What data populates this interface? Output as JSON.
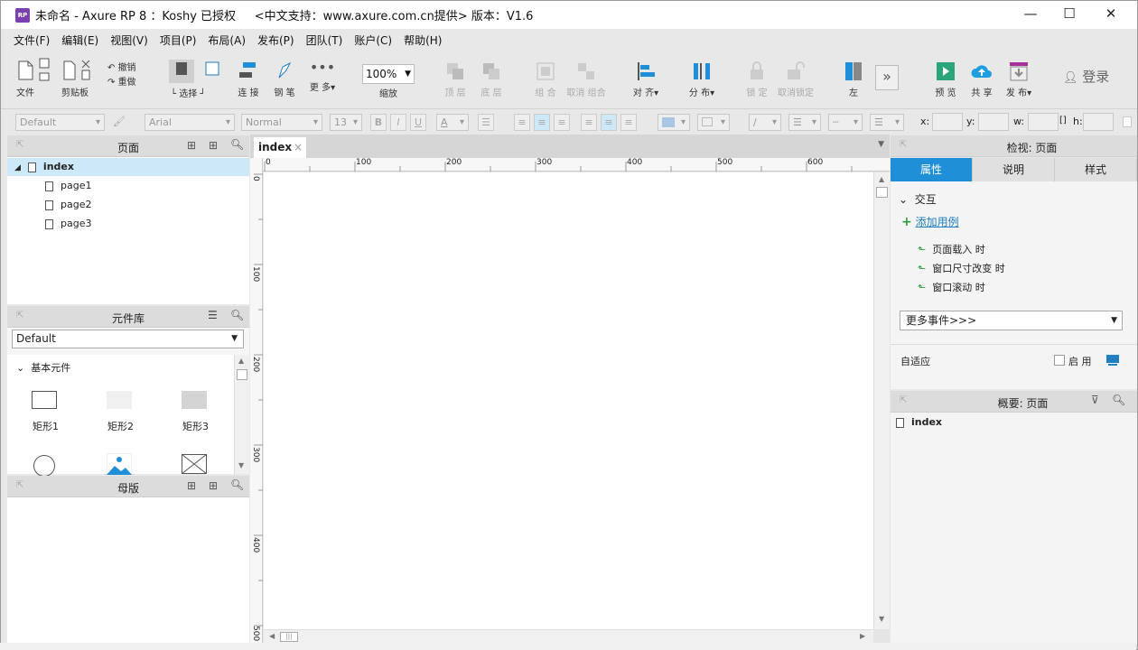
{
  "window": {
    "title": "未命名 - Axure RP 8 ：Koshy 已授权     <中文支持：www.axure.com.cn提供> 版本：V1.6",
    "app_icon_text": "RP",
    "minimize": "—",
    "maximize": "☐",
    "close": "✕"
  },
  "menu": [
    "文件(F)",
    "编辑(E)",
    "视图(V)",
    "项目(P)",
    "布局(A)",
    "发布(P)",
    "团队(T)",
    "账户(C)",
    "帮助(H)"
  ],
  "toolbar": {
    "file": "文件",
    "clipboard": "剪贴板",
    "undo": "撤销",
    "redo": "重做",
    "select": "选择",
    "connect": "连 接",
    "pen": "钢 笔",
    "more": "更 多▾",
    "zoom_value": "100%",
    "zoom": "缩放",
    "top": "顶 层",
    "bottom": "底 层",
    "group": "组 合",
    "ungroup": "取消 组合",
    "align": "对 齐▾",
    "distribute": "分 布▾",
    "lock": "锁 定",
    "unlock": "取消锁定",
    "left": "左",
    "preview": "预 览",
    "share": "共 享",
    "publish": "发 布▾",
    "login": "登录"
  },
  "format_bar": {
    "style": "Default",
    "font": "Arial",
    "weight": "Normal",
    "size": "13",
    "x_label": "x:",
    "y_label": "y:",
    "w_label": "w:",
    "h_label": "h:",
    "bold": "B",
    "italic": "I",
    "underline": "U",
    "font_color": "A"
  },
  "pages_panel": {
    "title": "页面",
    "root": "index",
    "children": [
      "page1",
      "page2",
      "page3"
    ]
  },
  "widgets_panel": {
    "title": "元件库",
    "library": "Default",
    "category": "基本元件",
    "items": [
      "矩形1",
      "矩形2",
      "矩形3"
    ]
  },
  "masters_panel": {
    "title": "母版"
  },
  "canvas": {
    "tab": "index",
    "tab_close": "×",
    "ruler_h": [
      "0",
      "100",
      "200",
      "300",
      "400",
      "500",
      "600"
    ],
    "ruler_v": [
      "0",
      "100",
      "200",
      "300",
      "400",
      "500"
    ]
  },
  "inspector": {
    "title": "检视: 页面",
    "tabs": [
      "属性",
      "说明",
      "样式"
    ],
    "section": "交互",
    "add_case": "添加用例",
    "events": [
      "页面载入 时",
      "窗口尺寸改变 时",
      "窗口滚动 时"
    ],
    "more_events": "更多事件>>>",
    "adaptive": "自适应",
    "enable": "启 用"
  },
  "outline": {
    "title": "概要: 页面",
    "item": "index"
  },
  "colors": {
    "accent": "#1f90d8",
    "selection": "#cde8f7",
    "green": "#2a9d3a"
  }
}
